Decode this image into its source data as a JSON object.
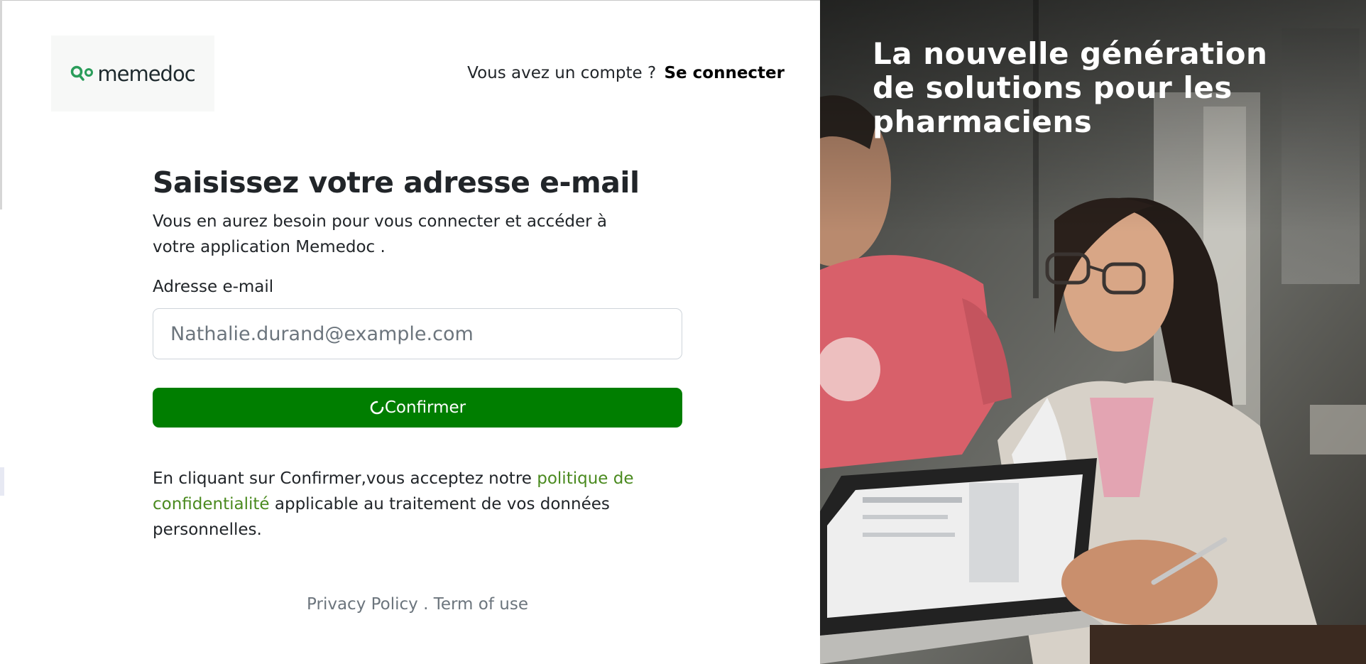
{
  "brand": {
    "name": "memedoc",
    "accent_color": "#007e00",
    "link_color": "#4a8a1f"
  },
  "header": {
    "account_question": "Vous avez un compte ?",
    "login_link": "Se connecter"
  },
  "form": {
    "heading": "Saisissez votre adresse e-mail",
    "subtitle": "Vous en aurez besoin pour vous connecter et accéder à votre application Memedoc .",
    "email_label": "Adresse e-mail",
    "email_placeholder": "Nathalie.durand@example.com",
    "email_value": "",
    "confirm_label": "Confirmer",
    "confirm_icon": "spinner-icon"
  },
  "consent": {
    "prefix": "En cliquant sur Confirmer,vous acceptez notre ",
    "link": "politique de confidentialité",
    "suffix": " applicable au traitement de vos données personnelles."
  },
  "footer": {
    "privacy": "Privacy Policy",
    "separator": " . ",
    "terms": "Term of use"
  },
  "hero": {
    "title": "La nouvelle génération de solutions pour les pharmaciens"
  }
}
